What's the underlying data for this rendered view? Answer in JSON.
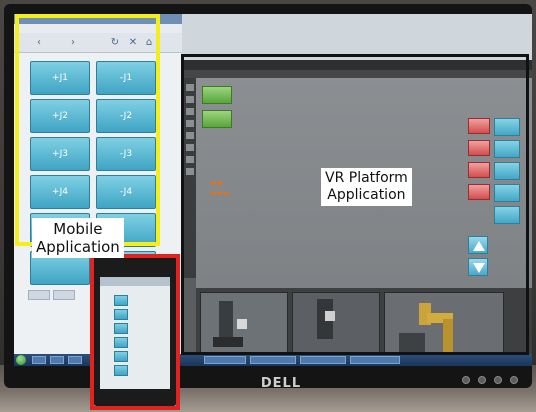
{
  "labels": {
    "mobile_application": [
      "Mobile",
      "Application"
    ],
    "vr_platform_application": [
      "VR Platform",
      "Application"
    ],
    "monitor_brand": "DELL"
  },
  "left_window": {
    "key_rows": [
      [
        "+J1",
        "-J1"
      ],
      [
        "+J2",
        "-J2"
      ],
      [
        "+J3",
        "-J3"
      ],
      [
        "+J4",
        "-J4"
      ],
      [
        "",
        ""
      ],
      [
        "",
        ""
      ]
    ]
  },
  "colors": {
    "mobile_highlight": "#f4ee1a",
    "phone_highlight": "#e2221e",
    "vr_highlight": "#111111",
    "joint_button": "#3fa4c4"
  }
}
